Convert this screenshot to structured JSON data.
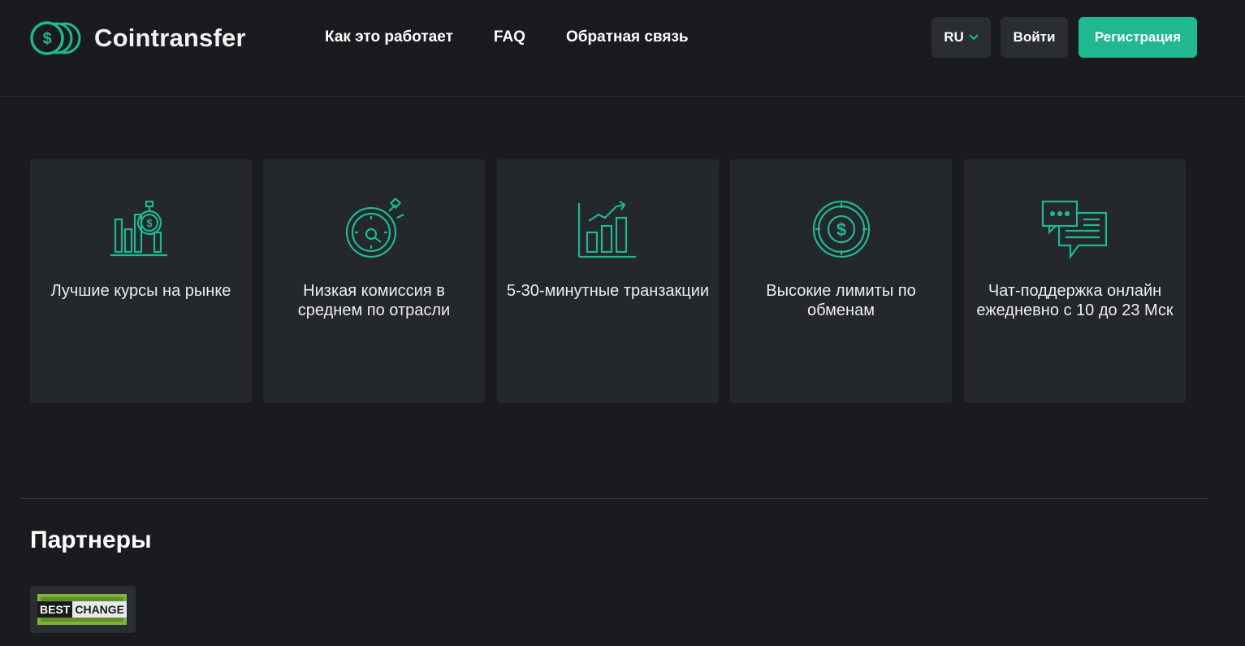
{
  "brand": {
    "name": "Cointransfer",
    "accent_color": "#1fb890",
    "icon": "coins-dollar-icon"
  },
  "nav": {
    "items": [
      "Как это работает",
      "FAQ",
      "Обратная связь"
    ]
  },
  "header": {
    "language": "RU",
    "login_label": "Войти",
    "register_label": "Регистрация"
  },
  "features": [
    {
      "icon": "chart-stopwatch-dollar-icon",
      "label": "Лучшие курсы на рынке"
    },
    {
      "icon": "stopwatch-icon",
      "label": "Низкая комиссия в среднем по отрасли"
    },
    {
      "icon": "growth-chart-icon",
      "label": "5-30-минутные транзакции"
    },
    {
      "icon": "dollar-coin-icon",
      "label": "Высокие лимиты по обменам"
    },
    {
      "icon": "chat-bubbles-icon",
      "label": "Чат-поддержка онлайн ежедневно с 10 до 23 Мск"
    }
  ],
  "partners": {
    "title": "Партнеры",
    "items": [
      {
        "best": "BEST",
        "change": "CHANGE"
      }
    ]
  }
}
